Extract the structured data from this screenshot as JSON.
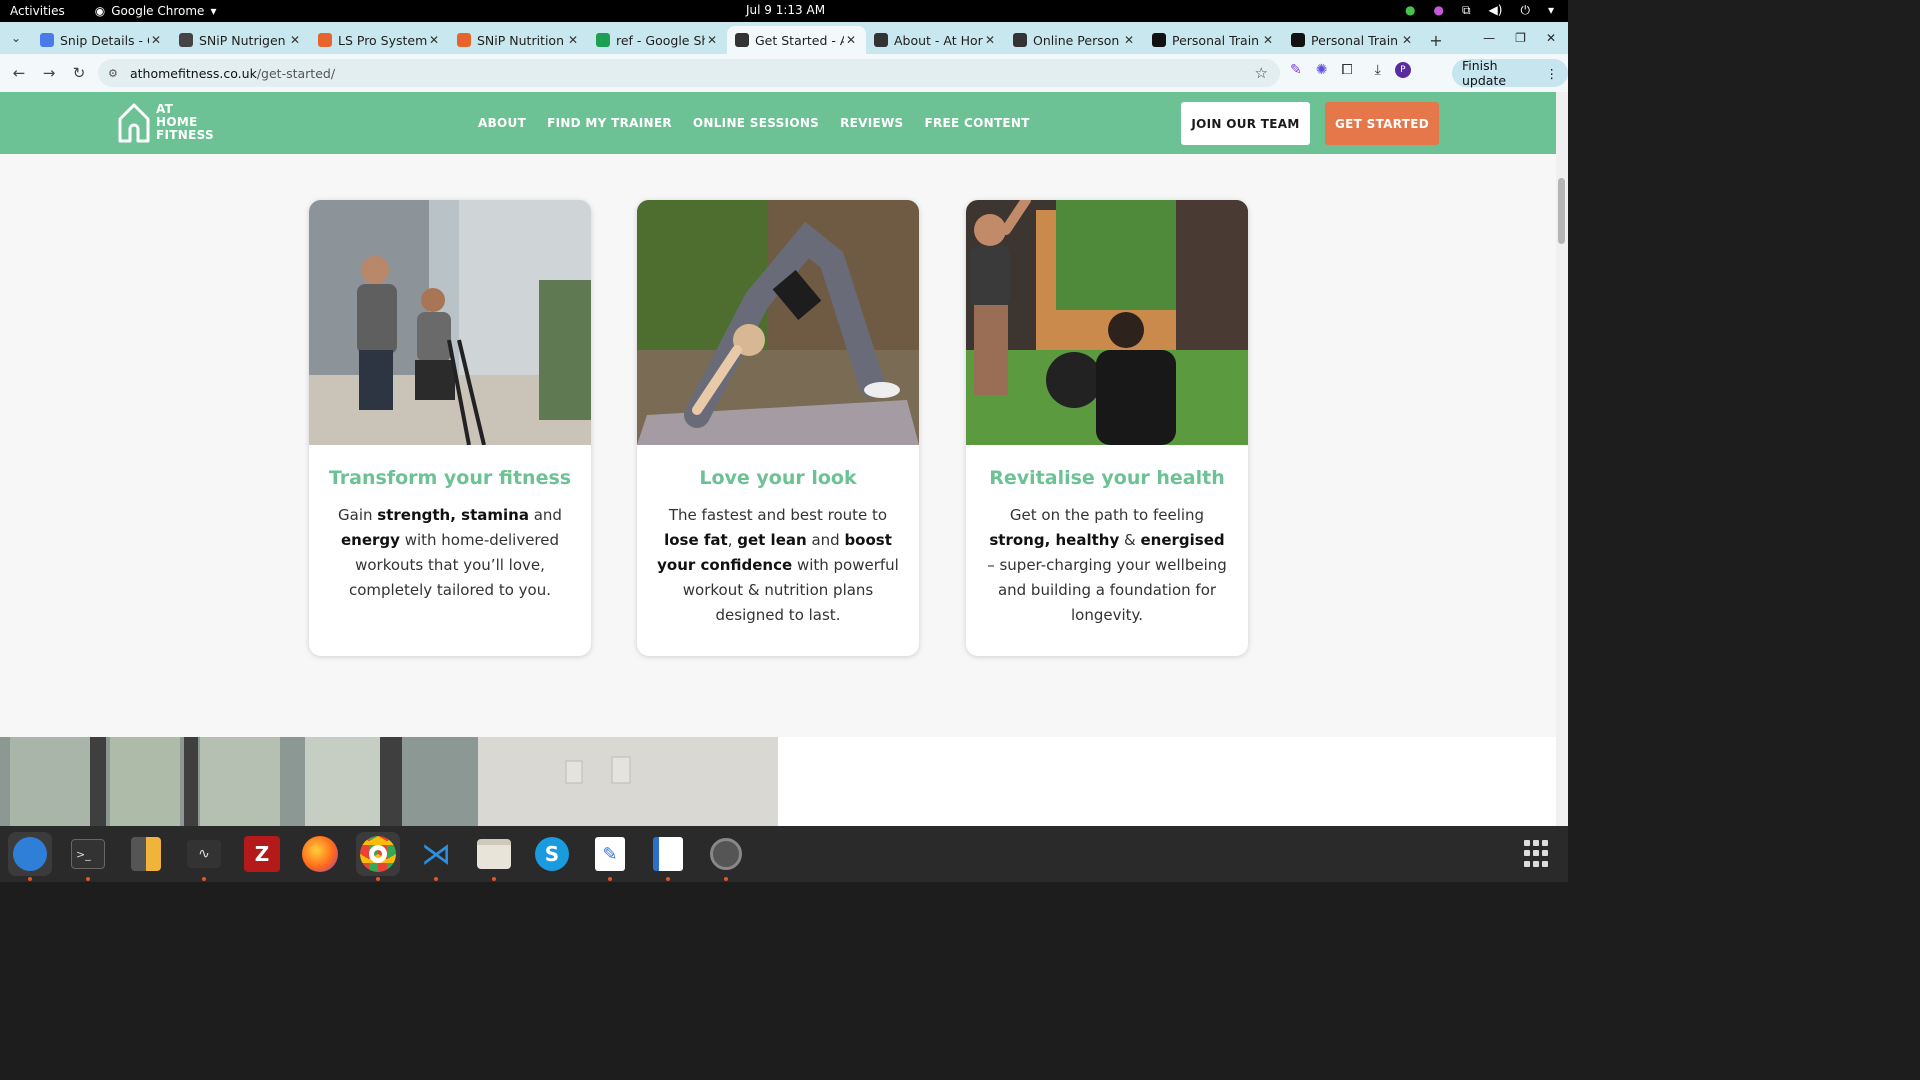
{
  "os_bar": {
    "activities": "Activities",
    "app_name": "Google Chrome",
    "clock": "Jul 9  1:13 AM"
  },
  "tabs": [
    {
      "title": "Snip Details - C",
      "icon": "google-docs-icon",
      "color": "#4a7be8"
    },
    {
      "title": "SNiP Nutrigen",
      "icon": "snip-logo-icon",
      "color": "#444444"
    },
    {
      "title": "LS Pro System",
      "icon": "ls-pro-icon",
      "color": "#e8642d"
    },
    {
      "title": "SNiP Nutrition",
      "icon": "snip-nutrition-icon",
      "color": "#e8642d"
    },
    {
      "title": "ref - Google Sh",
      "icon": "google-sheets-icon",
      "color": "#1e9e52"
    },
    {
      "title": "Get Started - A",
      "icon": "at-home-fitness-icon",
      "color": "#333333",
      "active": true
    },
    {
      "title": "About - At Hor",
      "icon": "at-home-fitness-icon",
      "color": "#333333"
    },
    {
      "title": "Online Person",
      "icon": "at-home-fitness-icon",
      "color": "#333333"
    },
    {
      "title": "Personal Train",
      "icon": "fs-logo-icon",
      "color": "#111111"
    },
    {
      "title": "Personal Train",
      "icon": "fs-logo-icon",
      "color": "#111111"
    }
  ],
  "address": {
    "domain": "athomefitness.co.uk",
    "path": "/get-started/"
  },
  "toolbar": {
    "finish_update": "Finish update",
    "profile_initial": "P"
  },
  "site": {
    "logo_lines": [
      "AT",
      "HOME",
      "FITNESS"
    ],
    "nav": [
      "ABOUT",
      "FIND MY TRAINER",
      "ONLINE SESSIONS",
      "REVIEWS",
      "FREE CONTENT"
    ],
    "join_button": "JOIN OUR TEAM",
    "start_button": "GET STARTED",
    "brand_green": "#6cc195",
    "brand_orange": "#e5774a"
  },
  "cards": [
    {
      "title": "Transform your fitness",
      "body_parts": [
        [
          "Gain ",
          false
        ],
        [
          "strength, stamina",
          true
        ],
        [
          " and ",
          false
        ],
        [
          "energy",
          true
        ],
        [
          " with home-delivered workouts that you’ll love, completely tailored to you.",
          false
        ]
      ]
    },
    {
      "title": "Love your look",
      "body_parts": [
        [
          "The fastest and best route to ",
          false
        ],
        [
          "lose fat",
          true
        ],
        [
          ", ",
          false
        ],
        [
          "get lean",
          true
        ],
        [
          " and ",
          false
        ],
        [
          "boost your confidence",
          true
        ],
        [
          " with powerful workout & nutrition plans designed to last.",
          false
        ]
      ]
    },
    {
      "title": "Revitalise your health",
      "body_parts": [
        [
          "Get on the path to feeling ",
          false
        ],
        [
          "strong, healthy",
          true
        ],
        [
          " & ",
          false
        ],
        [
          "energised",
          true
        ],
        [
          " – super-charging your wellbeing and building a foundation for longevity.",
          false
        ]
      ]
    }
  ]
}
